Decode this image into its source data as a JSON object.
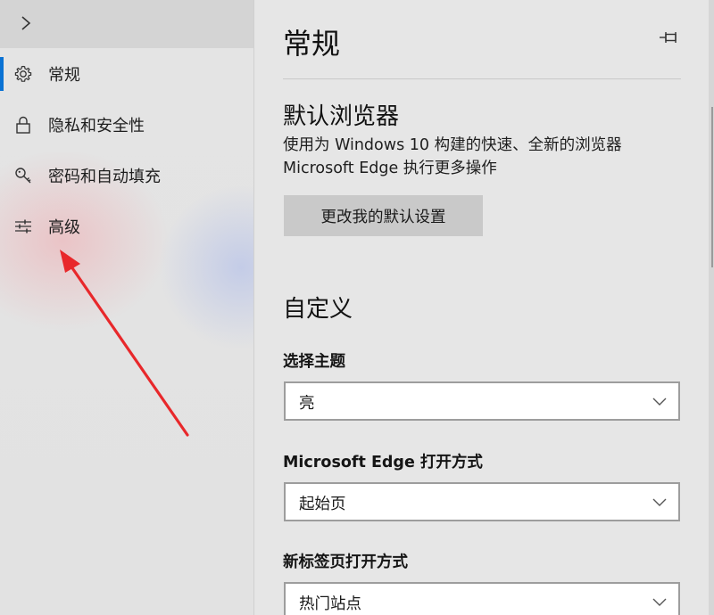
{
  "nav": {
    "items": [
      {
        "label": "常规",
        "icon": "gear-icon",
        "active": true
      },
      {
        "label": "隐私和安全性",
        "icon": "lock-icon",
        "active": false
      },
      {
        "label": "密码和自动填充",
        "icon": "key-icon",
        "active": false
      },
      {
        "label": "高级",
        "icon": "sliders-icon",
        "active": false
      }
    ],
    "expand_icon": "chevron-right-icon"
  },
  "panel": {
    "title": "常规",
    "pin_icon": "pin-icon",
    "default_browser": {
      "heading": "默认浏览器",
      "description_line1": "使用为 Windows 10 构建的快速、全新的浏览器",
      "description_line2": "Microsoft Edge 执行更多操作",
      "button_label": "更改我的默认设置"
    },
    "customize": {
      "heading": "自定义",
      "theme_label": "选择主题",
      "theme_value": "亮",
      "open_with_label": "Microsoft Edge 打开方式",
      "open_with_value": "起始页",
      "new_tab_label": "新标签页打开方式",
      "new_tab_value": "热门站点"
    }
  },
  "colors": {
    "accent": "#0a72d4",
    "annotation_arrow": "#e8282b"
  }
}
